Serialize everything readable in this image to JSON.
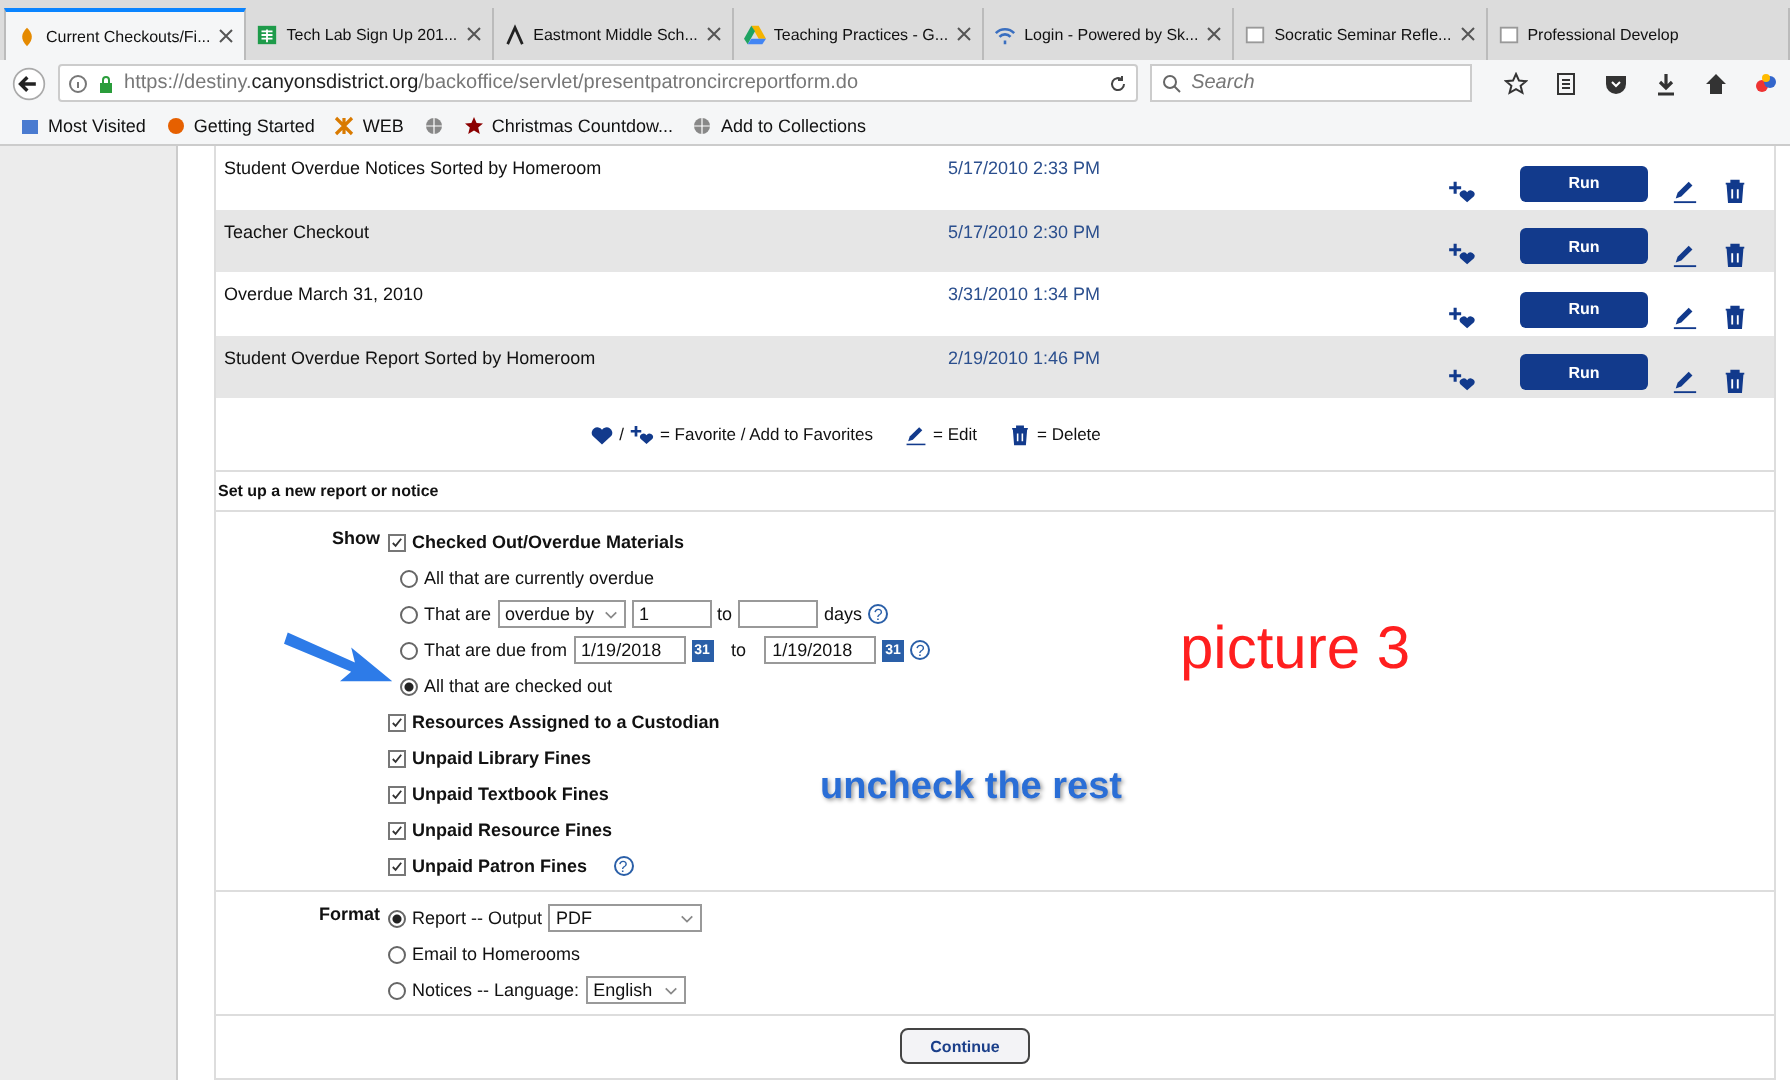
{
  "tabs": [
    {
      "title": "Current Checkouts/Fi...",
      "selected": true
    },
    {
      "title": "Tech Lab Sign Up 201...",
      "selected": false
    },
    {
      "title": "Eastmont Middle Sch...",
      "selected": false
    },
    {
      "title": "Teaching Practices - G...",
      "selected": false
    },
    {
      "title": "Login - Powered by Sk...",
      "selected": false
    },
    {
      "title": "Socratic Seminar Refle...",
      "selected": false
    },
    {
      "title": "Professional Develop",
      "selected": false
    }
  ],
  "address": {
    "prefix": "https://destiny.",
    "domain": "canyonsdistrict.org",
    "path": "/backoffice/servlet/presentpatroncircreportform.do"
  },
  "search": {
    "placeholder": "Search"
  },
  "bookmarks": [
    {
      "kind": "link",
      "label": "Most Visited"
    },
    {
      "kind": "link",
      "label": "Getting Started"
    },
    {
      "kind": "link",
      "label": "WEB"
    },
    {
      "kind": "icon"
    },
    {
      "kind": "link",
      "label": "Christmas Countdow..."
    },
    {
      "kind": "link",
      "label": "Add to Collections"
    }
  ],
  "reports": [
    {
      "name": "Student Overdue Notices Sorted by Homeroom",
      "date": "5/17/2010 2:33 PM",
      "run": "Run"
    },
    {
      "name": "Teacher Checkout",
      "date": "5/17/2010 2:30 PM",
      "run": "Run"
    },
    {
      "name": "Overdue March 31, 2010",
      "date": "3/31/2010 1:34 PM",
      "run": "Run"
    },
    {
      "name": "Student Overdue Report Sorted by Homeroom",
      "date": "2/19/2010 1:46 PM",
      "run": "Run"
    }
  ],
  "legend": {
    "slash": "/",
    "favorite": "= Favorite / Add to Favorites",
    "edit": "= Edit",
    "delete": "= Delete"
  },
  "section_title": "Set up a new report or notice",
  "show": {
    "label": "Show",
    "main": {
      "label": "Checked Out/Overdue Materials",
      "checked": true
    },
    "options": [
      {
        "kind": "plain",
        "label": "All that are currently overdue",
        "selected": false
      },
      {
        "kind": "range",
        "label": "That are",
        "select": "overdue by",
        "from": "1",
        "to_label": "to",
        "unit": "days",
        "help": "?",
        "selected": false
      },
      {
        "kind": "dates",
        "label": "That are due from",
        "from": "1/19/2018",
        "cal_from": "31",
        "to_label": "to",
        "to": "1/19/2018",
        "cal_to": "31",
        "help": "?",
        "selected": false
      },
      {
        "kind": "plain",
        "label": "All that are checked out",
        "selected": true
      }
    ],
    "others": [
      {
        "label": "Resources Assigned to a Custodian",
        "checked": true
      },
      {
        "label": "Unpaid Library Fines",
        "checked": true
      },
      {
        "label": "Unpaid Textbook Fines",
        "checked": true
      },
      {
        "label": "Unpaid Resource Fines",
        "checked": true
      },
      {
        "label": "Unpaid Patron Fines",
        "checked": true,
        "help": "?"
      }
    ]
  },
  "format": {
    "label": "Format",
    "options": [
      {
        "label": "Report -- Output",
        "select": "PDF",
        "selected": true
      },
      {
        "label": "Email to Homerooms",
        "selected": false
      },
      {
        "label": "Notices -- Language:",
        "select": "English",
        "selected": false
      }
    ]
  },
  "continue": "Continue",
  "annotations": [
    {
      "kind": "caption",
      "text": "picture 3"
    },
    {
      "kind": "note",
      "text": "uncheck the rest"
    }
  ]
}
